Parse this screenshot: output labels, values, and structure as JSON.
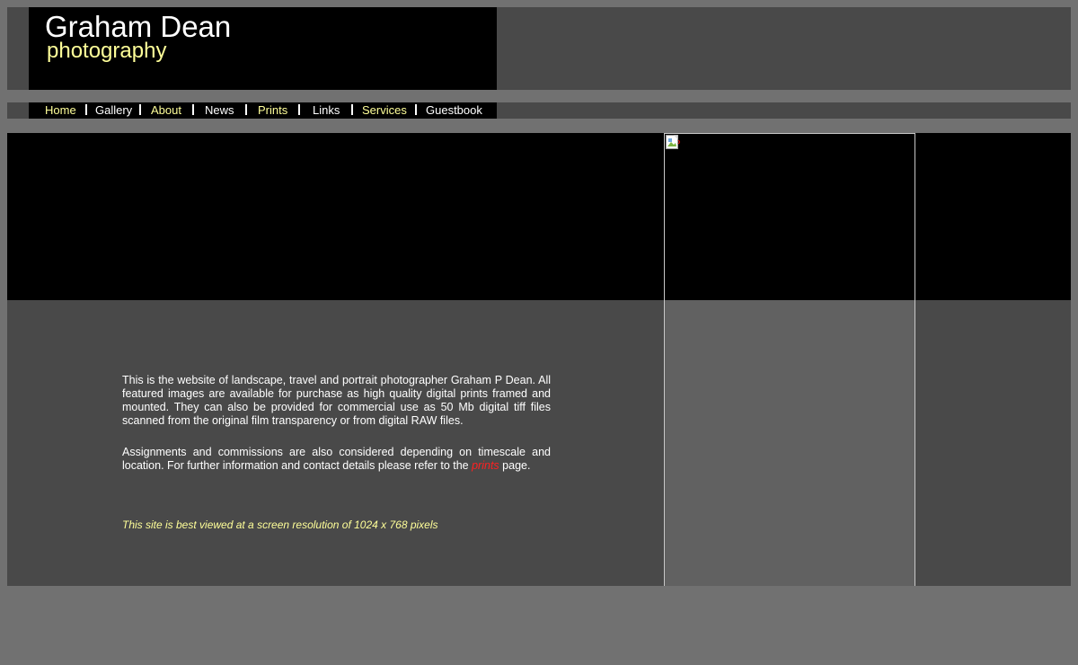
{
  "header": {
    "name": "Graham Dean",
    "subtitle": "photography"
  },
  "nav": [
    {
      "label": "Home"
    },
    {
      "label": "Gallery"
    },
    {
      "label": "About"
    },
    {
      "label": "News"
    },
    {
      "label": "Prints"
    },
    {
      "label": "Links"
    },
    {
      "label": "Services"
    },
    {
      "label": "Guestbook"
    }
  ],
  "hero": {
    "image_icon": "broken-image-icon"
  },
  "content": {
    "paragraph1": "This is the website of landscape, travel and portrait photographer Graham P Dean. All featured images are available for purchase as high quality digital prints framed and mounted. They can also be provided for commercial use as 50 Mb digital tiff files scanned from the original film transparency or from digital RAW files.",
    "paragraph2_before": "Assignments and commissions are also considered depending on timescale and location. For further information and contact details please refer to the ",
    "prints_link": "prints",
    "paragraph2_after": " page.",
    "resolution_note": "This site is best viewed at a screen resolution of 1024 x 768 pixels"
  },
  "colors": {
    "page_bg": "#717171",
    "band_bg": "#494949",
    "accent_yellow": "#ffff99",
    "link_red": "#ff2020"
  }
}
